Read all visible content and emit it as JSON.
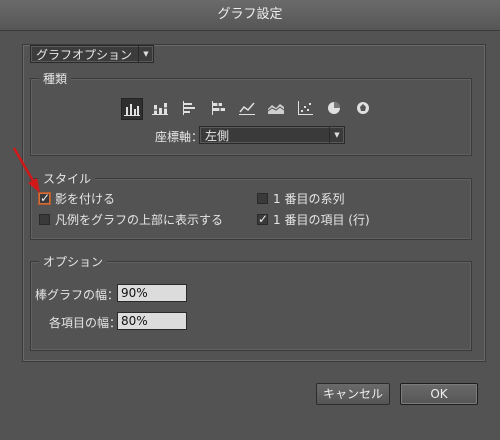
{
  "window": {
    "title": "グラフ設定"
  },
  "section_dropdown": {
    "value": "グラフオプション"
  },
  "kind_group": {
    "title": "種類",
    "chart_types": [
      {
        "name": "column-chart-icon",
        "selected": true
      },
      {
        "name": "stacked-column-chart-icon",
        "selected": false
      },
      {
        "name": "bar-chart-icon",
        "selected": false
      },
      {
        "name": "stacked-bar-chart-icon",
        "selected": false
      },
      {
        "name": "line-chart-icon",
        "selected": false
      },
      {
        "name": "area-chart-icon",
        "selected": false
      },
      {
        "name": "scatter-chart-icon",
        "selected": false
      },
      {
        "name": "pie-chart-icon",
        "selected": false
      },
      {
        "name": "radar-chart-icon",
        "selected": false
      }
    ],
    "axis_label": "座標軸：",
    "axis_value": "左側"
  },
  "style_group": {
    "title": "スタイル",
    "shadow": {
      "label": "影を付ける",
      "checked": true
    },
    "legend_top": {
      "label": "凡例をグラフの上部に表示する",
      "checked": false
    },
    "first_row": {
      "label": "1 番目の系列",
      "checked": false
    },
    "first_col": {
      "label": "1 番目の項目 (行)",
      "checked": true
    }
  },
  "options_group": {
    "title": "オプション",
    "bar_width_label": "棒グラフの幅：",
    "bar_width_value": "90%",
    "item_width_label": "各項目の幅：",
    "item_width_value": "80%"
  },
  "buttons": {
    "cancel": "キャンセル",
    "ok": "OK"
  },
  "colors": {
    "annotation_arrow": "#d01818",
    "highlight": "#d07040"
  }
}
